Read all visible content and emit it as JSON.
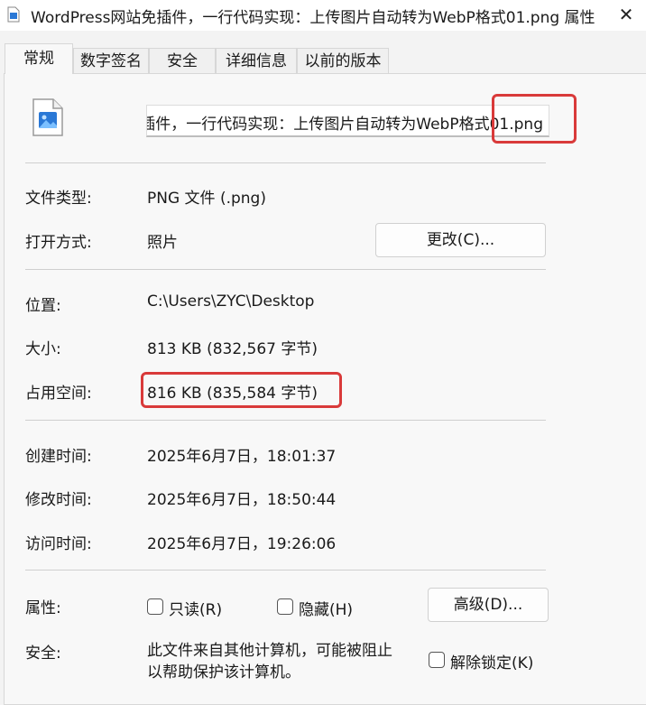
{
  "window": {
    "title": "WordPress网站免插件，一行代码实现：上传图片自动转为WebP格式01.png 属性",
    "close_glyph": "✕"
  },
  "tabs": [
    {
      "label": "常规",
      "active": true
    },
    {
      "label": "数字签名",
      "active": false
    },
    {
      "label": "安全",
      "active": false
    },
    {
      "label": "详细信息",
      "active": false
    },
    {
      "label": "以前的版本",
      "active": false
    }
  ],
  "general": {
    "file_name": "WordPress网站免插件，一行代码实现：上传图片自动转为WebP格式01.png",
    "file_type_label": "文件类型:",
    "file_type_value": "PNG 文件 (.png)",
    "open_with_label": "打开方式:",
    "open_with_value": "照片",
    "change_button": "更改(C)...",
    "location_label": "位置:",
    "location_value": "C:\\Users\\ZYC\\Desktop",
    "size_label": "大小:",
    "size_value": "813 KB (832,567 字节)",
    "size_on_disk_label": "占用空间:",
    "size_on_disk_value": "816 KB (835,584 字节)",
    "created_label": "创建时间:",
    "created_value": "2025年6月7日，18:01:37",
    "modified_label": "修改时间:",
    "modified_value": "2025年6月7日，18:50:44",
    "accessed_label": "访问时间:",
    "accessed_value": "2025年6月7日，19:26:06",
    "attributes_label": "属性:",
    "readonly_label": "只读(R)",
    "hidden_label": "隐藏(H)",
    "advanced_button": "高级(D)...",
    "security_label": "安全:",
    "security_line1": "此文件来自其他计算机，可能被阻止",
    "security_line2": "以帮助保护该计算机。",
    "unblock_label": "解除锁定(K)"
  },
  "colors": {
    "highlight": "#d93a3a",
    "icon_blue": "#2a78d6"
  }
}
